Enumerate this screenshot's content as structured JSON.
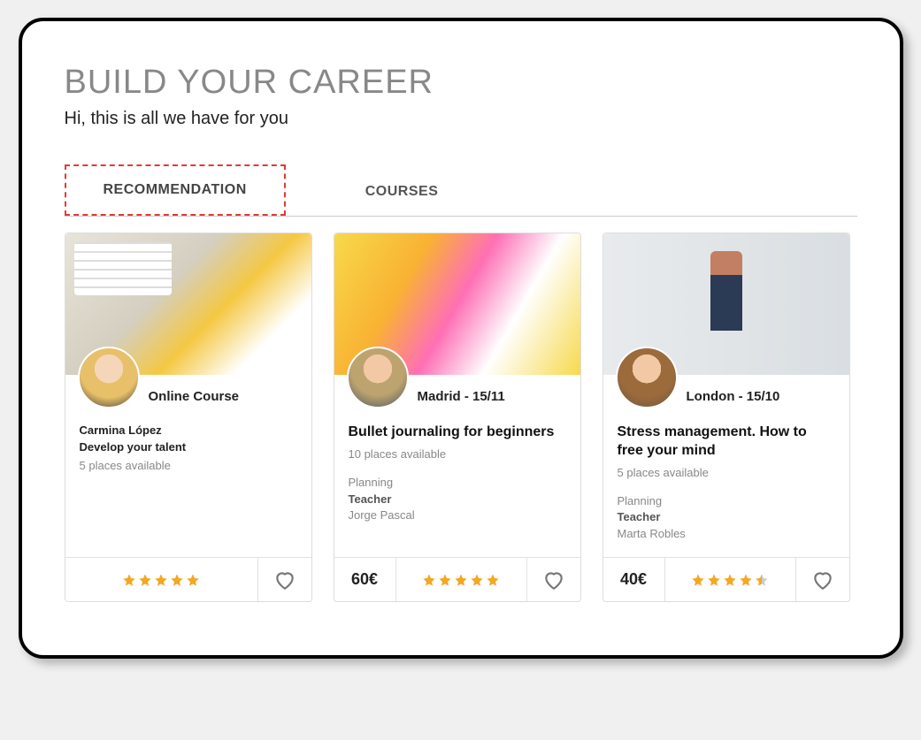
{
  "header": {
    "title": "BUILD YOUR CAREER",
    "subtitle": "Hi, this is all we have for you"
  },
  "tabs": {
    "items": [
      {
        "label": "RECOMMENDATION",
        "active": true
      },
      {
        "label": "COURSES",
        "active": false
      }
    ]
  },
  "cards": [
    {
      "location": "Online Course",
      "instructor": "Carmina López",
      "title": "Develop your talent",
      "places": "5 places available",
      "category": "",
      "teacher_label": "",
      "teacher": "",
      "price": "",
      "rating": 5,
      "rating_type": "full"
    },
    {
      "location": "Madrid - 15/11",
      "instructor": "",
      "title": "Bullet journaling for beginners",
      "places": "10 places available",
      "category": "Planning",
      "teacher_label": "Teacher",
      "teacher": "Jorge Pascal",
      "price": "60€",
      "rating": 5,
      "rating_type": "full"
    },
    {
      "location": "London - 15/10",
      "instructor": "",
      "title": "Stress management. How to free your mind",
      "places": "5 places available",
      "category": "Planning",
      "teacher_label": "Teacher",
      "teacher": "Marta Robles",
      "price": "40€",
      "rating": 4.5,
      "rating_type": "half"
    }
  ],
  "colors": {
    "accent": "#f5a623",
    "tab_highlight": "#e53935"
  }
}
